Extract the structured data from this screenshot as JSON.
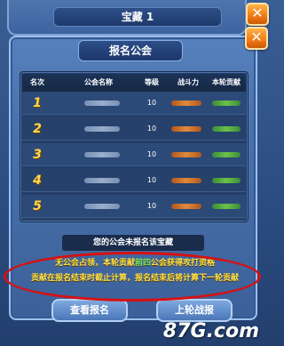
{
  "back_panel": {
    "title": "宝藏 1",
    "close_label": "✕"
  },
  "dialog": {
    "title": "报名公会",
    "close_label": "✕",
    "table": {
      "headers": [
        "名次",
        "公会名称",
        "等级",
        "战斗力",
        "本轮贡献"
      ],
      "rows": [
        {
          "rank": "1",
          "level": "10"
        },
        {
          "rank": "2",
          "level": "10"
        },
        {
          "rank": "3",
          "level": "10"
        },
        {
          "rank": "4",
          "level": "10"
        },
        {
          "rank": "5",
          "level": "10"
        }
      ]
    },
    "status_banner": "您的公会未报名该宝藏",
    "notice": {
      "line1_pre": "无公会占领，本轮贡献",
      "line1_highlight": "前四",
      "line1_post": "公会获得攻打资格",
      "line2": "贡献在报名结束时截止计算，报名结束后将计算下一轮贡献"
    },
    "buttons": {
      "left": "查看报名",
      "right": "上轮战报"
    }
  },
  "watermark": "87G.com",
  "colors": {
    "rank": "#ffd84a",
    "notice_text": "#ffe24a",
    "notice_highlight": "#78e85a",
    "annotation_oval": "#d81010",
    "close_button": "#f07a16"
  }
}
